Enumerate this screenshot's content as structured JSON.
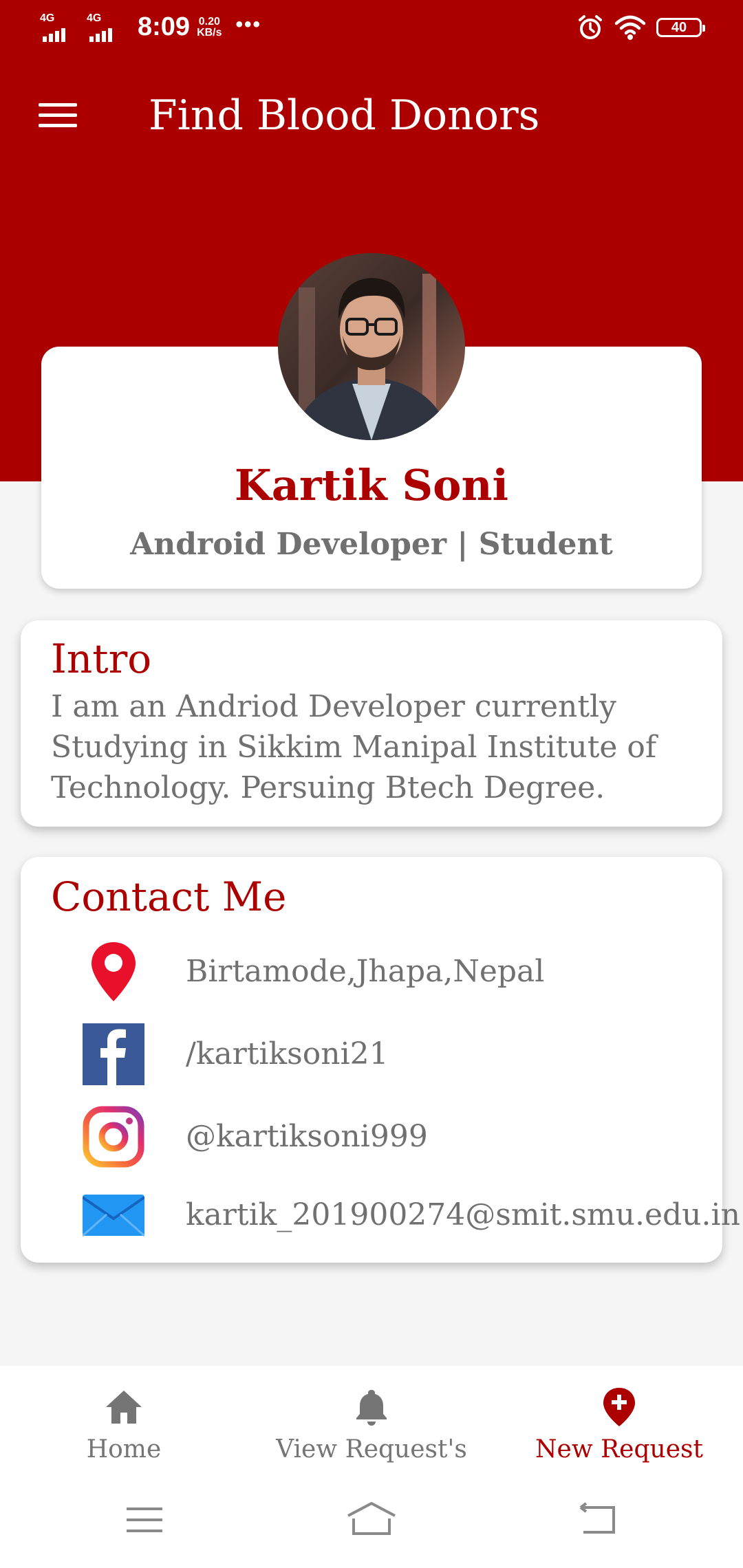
{
  "status_bar": {
    "network_1": "4G",
    "network_2": "4G",
    "time": "8:09",
    "speed_value": "0.20",
    "speed_unit": "KB/s",
    "more": "•••",
    "battery": "40",
    "icons": [
      "signal-icon",
      "alarm-icon",
      "wifi-icon",
      "battery-icon"
    ]
  },
  "toolbar": {
    "title": "Find Blood Donors",
    "menu_icon": "hamburger-menu-icon"
  },
  "profile": {
    "name": "Kartik Soni",
    "role": "Android Developer | Student",
    "avatar": "profile-photo"
  },
  "intro": {
    "title": "Intro",
    "text": "I am an Andriod Developer currently Studying in Sikkim Manipal Institute of Technology. Persuing Btech Degree."
  },
  "contact": {
    "title": "Contact Me",
    "items": [
      {
        "icon": "location-pin-icon",
        "text": "Birtamode,Jhapa,Nepal"
      },
      {
        "icon": "facebook-icon",
        "text": "/kartiksoni21"
      },
      {
        "icon": "instagram-icon",
        "text": "@kartiksoni999"
      },
      {
        "icon": "email-icon",
        "text": "kartik_201900274@smit.smu.edu.in"
      }
    ]
  },
  "bottom_nav": {
    "items": [
      {
        "label": "Home",
        "icon": "home-icon",
        "active": false
      },
      {
        "label": "View Request's",
        "icon": "bell-icon",
        "active": false
      },
      {
        "label": "New Request",
        "icon": "add-location-icon",
        "active": true
      }
    ]
  },
  "system_nav": {
    "items": [
      "menu-icon",
      "home-icon",
      "back-icon"
    ]
  },
  "colors": {
    "primary": "#ac0000",
    "text_gray": "#707070",
    "background": "#f5f5f5",
    "card": "#ffffff"
  }
}
